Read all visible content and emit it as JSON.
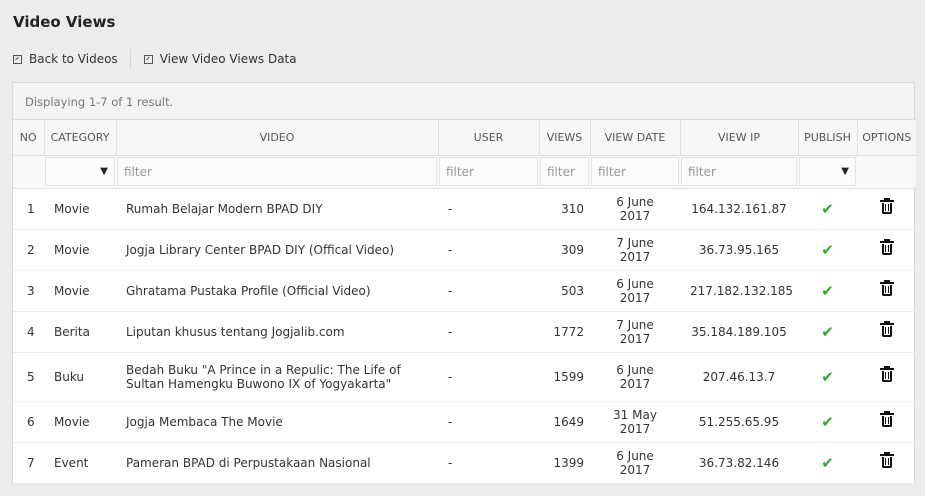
{
  "page": {
    "title": "Video Views"
  },
  "toolbar": {
    "back_label": "Back to Videos",
    "data_label": "View Video Views Data"
  },
  "grid": {
    "summary": "Displaying 1-7 of 1 result.",
    "columns": [
      "NO",
      "CATEGORY",
      "VIDEO",
      "USER",
      "VIEWS",
      "VIEW DATE",
      "VIEW IP",
      "PUBLISH",
      "OPTIONS"
    ],
    "filter_placeholder": "filter",
    "rows": [
      {
        "no": "1",
        "category": "Movie",
        "video": "Rumah Belajar Modern BPAD DIY",
        "user": "-",
        "views": "310",
        "date": "6 June 2017",
        "ip": "164.132.161.87",
        "published": true
      },
      {
        "no": "2",
        "category": "Movie",
        "video": "Jogja Library Center BPAD DIY (Offical Video)",
        "user": "-",
        "views": "309",
        "date": "7 June 2017",
        "ip": "36.73.95.165",
        "published": true
      },
      {
        "no": "3",
        "category": "Movie",
        "video": "Ghratama Pustaka Profile (Official Video)",
        "user": "-",
        "views": "503",
        "date": "6 June 2017",
        "ip": "217.182.132.185",
        "published": true
      },
      {
        "no": "4",
        "category": "Berita",
        "video": "Liputan khusus tentang Jogjalib.com",
        "user": "-",
        "views": "1772",
        "date": "7 June 2017",
        "ip": "35.184.189.105",
        "published": true
      },
      {
        "no": "5",
        "category": "Buku",
        "video": "Bedah Buku \"A Prince in a Repulic: The Life of Sultan Hamengku Buwono IX of Yogyakarta\"",
        "user": "-",
        "views": "1599",
        "date": "6 June 2017",
        "ip": "207.46.13.7",
        "published": true
      },
      {
        "no": "6",
        "category": "Movie",
        "video": "Jogja Membaca The Movie",
        "user": "-",
        "views": "1649",
        "date": "31 May 2017",
        "ip": "51.255.65.95",
        "published": true
      },
      {
        "no": "7",
        "category": "Event",
        "video": "Pameran BPAD di Perpustakaan Nasional",
        "user": "-",
        "views": "1399",
        "date": "6 June 2017",
        "ip": "36.73.82.146",
        "published": true
      }
    ]
  }
}
